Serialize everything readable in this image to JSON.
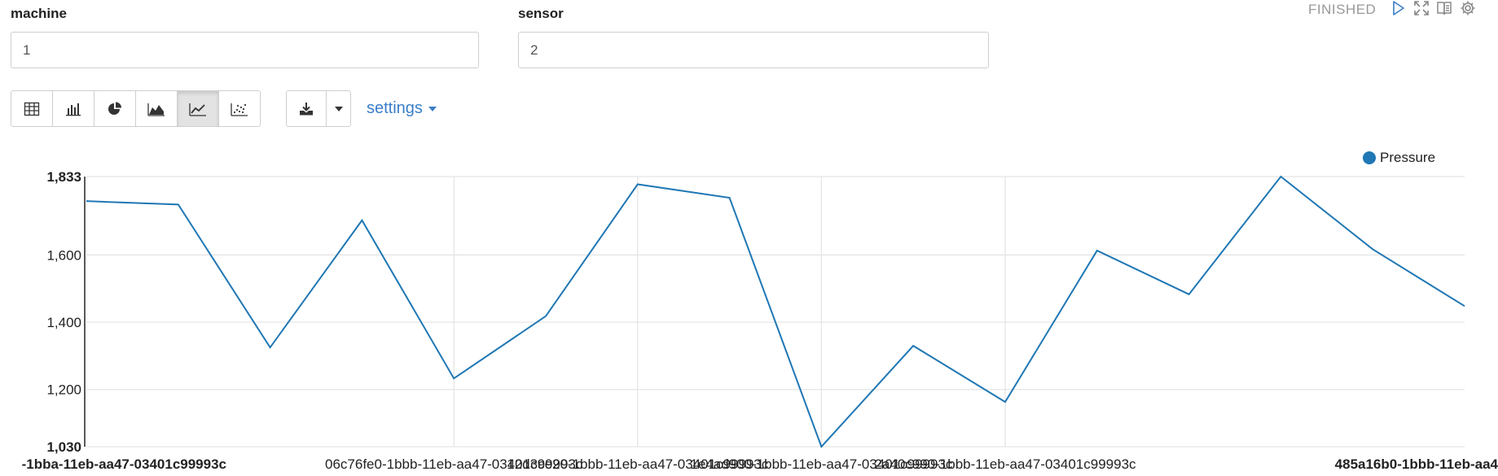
{
  "status": "FINISHED",
  "header_icons": [
    "play-icon",
    "expand-icon",
    "book-icon",
    "gear-icon"
  ],
  "form": {
    "machine": {
      "label": "machine",
      "value": "1"
    },
    "sensor": {
      "label": "sensor",
      "value": "2"
    }
  },
  "toolbar": {
    "chart_types": [
      {
        "name": "table-view-button",
        "icon": "table-icon",
        "active": false
      },
      {
        "name": "bar-chart-button",
        "icon": "bar-chart-icon",
        "active": false
      },
      {
        "name": "pie-chart-button",
        "icon": "pie-chart-icon",
        "active": false
      },
      {
        "name": "area-chart-button",
        "icon": "area-chart-icon",
        "active": false
      },
      {
        "name": "line-chart-button",
        "icon": "line-chart-icon",
        "active": true
      },
      {
        "name": "scatter-chart-button",
        "icon": "scatter-chart-icon",
        "active": false
      }
    ],
    "download_icon": "download-icon",
    "dropdown_icon": "caret-down-icon",
    "settings_label": "settings"
  },
  "colors": {
    "series": "#1f77b4",
    "accent": "#3a7ec7",
    "grid": "#e5e5e5"
  },
  "chart_data": {
    "type": "line",
    "series": [
      {
        "name": "Pressure",
        "values": [
          1760,
          1750,
          1325,
          1703,
          1233,
          1418,
          1810,
          1770,
          1030,
          1330,
          1163,
          1613,
          1483,
          1833,
          1617,
          1448
        ]
      }
    ],
    "ylim": [
      1030,
      1833
    ],
    "yticks": [
      "1,833",
      "1,600",
      "1,400",
      "1,200",
      "1,030"
    ],
    "ytick_values": [
      1833,
      1600,
      1400,
      1200,
      1030
    ],
    "xtick_labels": [
      {
        "index": 0,
        "text": "-1bba-11eb-aa47-03401c99993c",
        "bold": true,
        "align": "end"
      },
      {
        "index": 4,
        "text": "06c76fe0-1bbb-11eb-aa47-03401c99993c",
        "bold": false,
        "align": "middle"
      },
      {
        "index": 6,
        "text": "12d3ce20-1bbb-11eb-aa47-03401c99993c",
        "bold": false,
        "align": "middle"
      },
      {
        "index": 8,
        "text": "1e4ad900-1bbb-11eb-aa47-03401c99993c",
        "bold": false,
        "align": "middle"
      },
      {
        "index": 10,
        "text": "2a40c990-1bbb-11eb-aa47-03401c99993c",
        "bold": false,
        "align": "middle"
      },
      {
        "index": 15,
        "text": "485a16b0-1bbb-11eb-aa4",
        "bold": true,
        "align": "end"
      }
    ],
    "legend_position": "top-right",
    "grid": true
  }
}
